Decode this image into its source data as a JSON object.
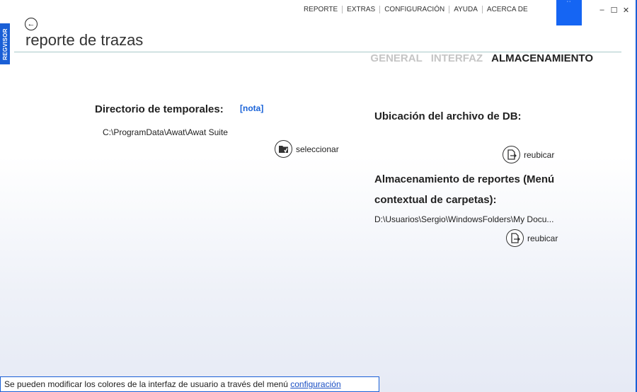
{
  "app": {
    "side_tab_label": "REGVISOR",
    "page_title": "reporte de trazas"
  },
  "topnav": {
    "items": [
      "REPORTE",
      "EXTRAS",
      "CONFIGURACIÓN",
      "AYUDA",
      "ACERCA DE"
    ]
  },
  "window_controls": {
    "minimize": "–",
    "maximize": "☐",
    "close": "✕"
  },
  "accent_box_glyph": "˙˙",
  "tabs": [
    {
      "label": "GENERAL",
      "active": false
    },
    {
      "label": "INTERFAZ",
      "active": false
    },
    {
      "label": "ALMACENAMIENTO",
      "active": true
    }
  ],
  "left_section": {
    "heading": "Directorio de temporales:",
    "note_link": "[nota]",
    "path": "C:\\ProgramData\\Awat\\Awat Suite",
    "action_label": "seleccionar",
    "action_icon": "folder-icon"
  },
  "right_section": {
    "db_heading": "Ubicación del archivo de DB:",
    "db_action_label": "reubicar",
    "db_action_icon": "move-file-icon",
    "reports_heading_line1": "Almacenamiento de reportes (Menú",
    "reports_heading_line2": "contextual de carpetas):",
    "reports_path": "D:\\Usuarios\\Sergio\\WindowsFolders\\My Docu...",
    "reports_action_label": "reubicar",
    "reports_action_icon": "move-file-icon"
  },
  "status_bar": {
    "text": "Se pueden modificar los colores de la interfaz de usuario a través del menú ",
    "link": "configuración"
  },
  "colors": {
    "accent": "#1565f3",
    "link": "#1a63d8",
    "tab_inactive": "#c5c5c5"
  }
}
